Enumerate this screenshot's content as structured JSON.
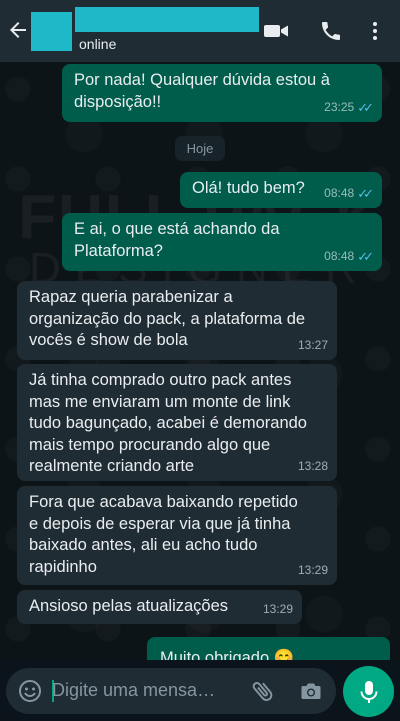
{
  "header": {
    "status": "online"
  },
  "date_chip": "Hoje",
  "messages": [
    {
      "direction": "out",
      "lines": [
        "Por nada! Qualquer dúvida estou à",
        "disposição!!"
      ],
      "time": "23:25",
      "read": true
    },
    {
      "direction": "out",
      "lines": [
        "Olá! tudo bem?"
      ],
      "time": "08:48",
      "read": true
    },
    {
      "direction": "out",
      "lines": [
        "E ai, o que está achando da",
        "Plataforma?"
      ],
      "time": "08:48",
      "read": true
    },
    {
      "direction": "in",
      "lines": [
        "Rapaz queria parabenizar a",
        "organização do pack, a plataforma de",
        "vocês é show de bola"
      ],
      "time": "13:27"
    },
    {
      "direction": "in",
      "lines": [
        "Já tinha comprado outro pack antes",
        "mas me enviaram um monte de link",
        "tudo bagunçado, acabei é demorando",
        "mais tempo procurando algo que",
        "realmente criando arte"
      ],
      "time": "13:28"
    },
    {
      "direction": "in",
      "lines": [
        "Fora que acabava baixando repetido",
        "e depois de esperar via que já tinha",
        "baixado antes, ali eu acho tudo",
        "rapidinho"
      ],
      "time": "13:29"
    },
    {
      "direction": "in",
      "lines": [
        "Ansioso pelas atualizações"
      ],
      "time": "13:29"
    },
    {
      "direction": "out",
      "lines": [
        "Muito obrigado 😊"
      ],
      "time": ""
    }
  ],
  "watermark": {
    "line1": "FULL PACK",
    "line2": "DESIGNER"
  },
  "composer": {
    "placeholder": "Digite uma mensa…"
  },
  "colors": {
    "outgoing": "#005c4b",
    "incoming": "#202c33",
    "accent": "#00a884",
    "read_ticks": "#53bdeb",
    "redaction": "#1fb8c9"
  }
}
